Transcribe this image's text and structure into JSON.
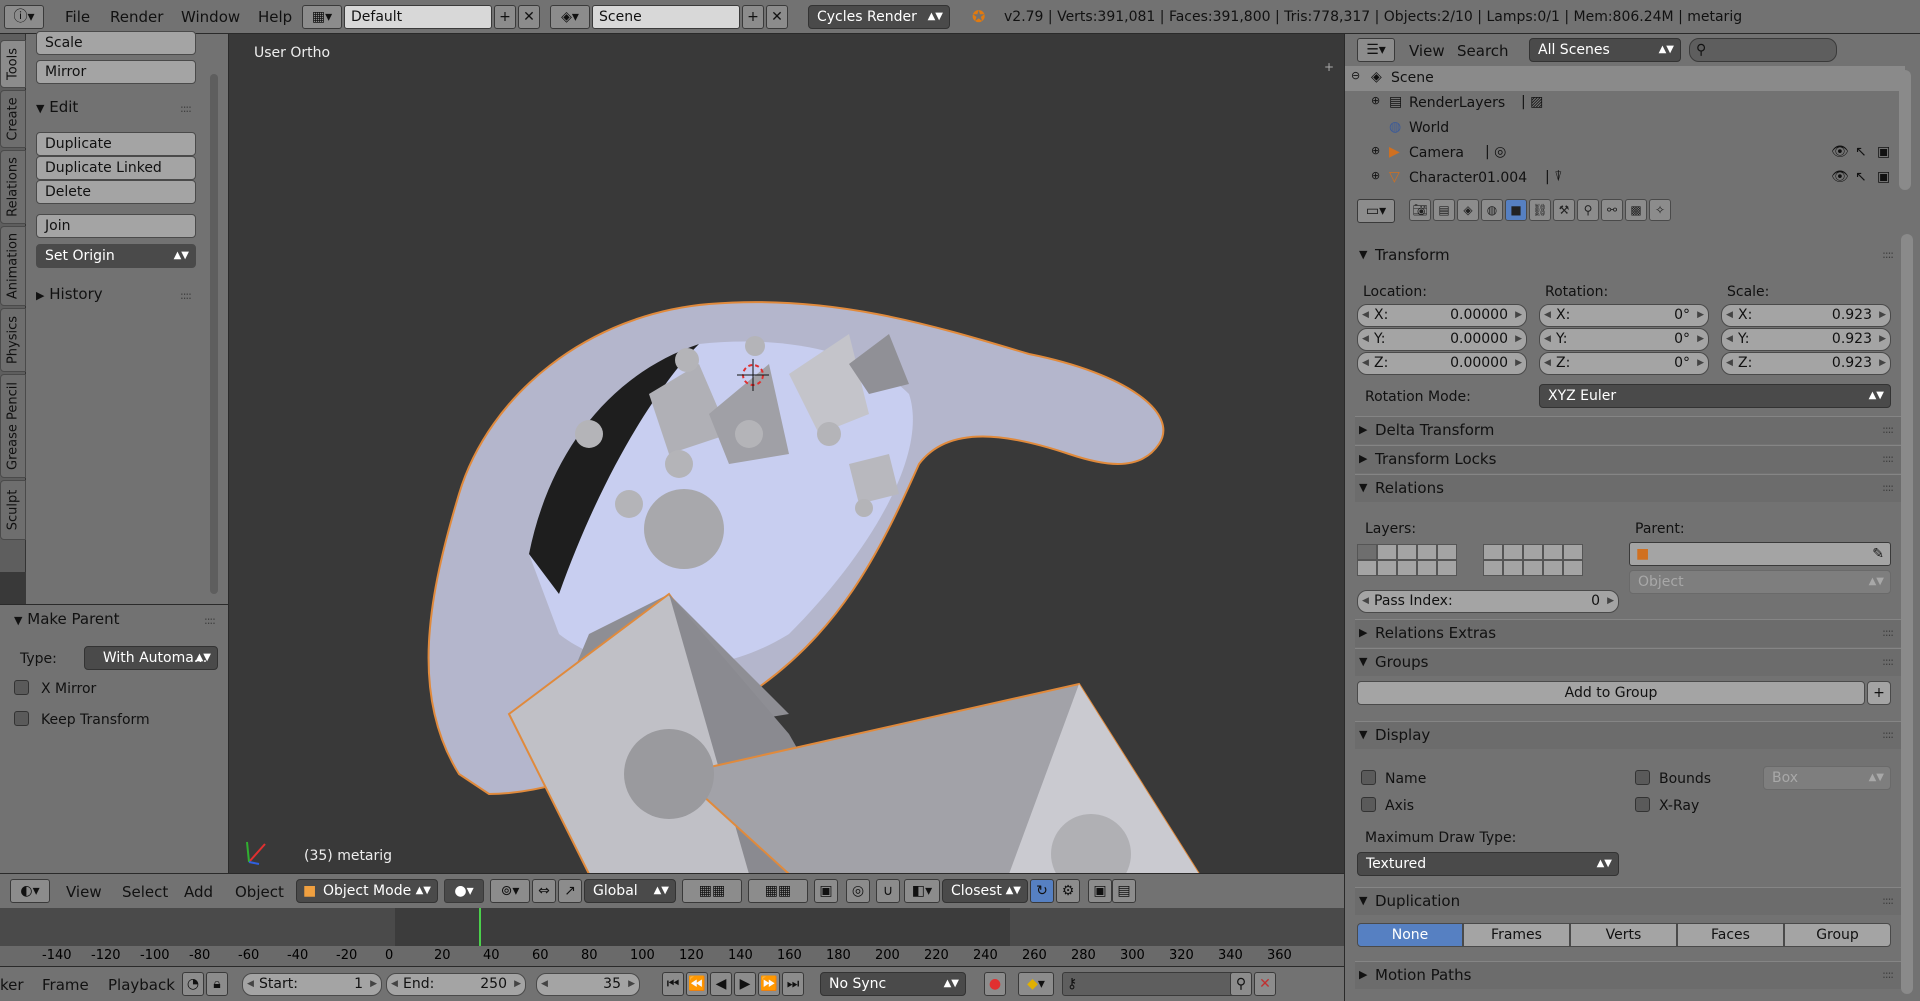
{
  "topbar": {
    "menus": [
      "File",
      "Render",
      "Window",
      "Help"
    ],
    "layout": "Default",
    "scene": "Scene",
    "engine": "Cycles Render",
    "stats": "v2.79 | Verts:391,081 | Faces:391,800 | Tris:778,317 | Objects:2/10 | Lamps:0/1 | Mem:806.24M | metarig"
  },
  "vtabs": [
    "Tools",
    "Create",
    "Relations",
    "Animation",
    "Physics",
    "Grease Pencil",
    "Sculpt"
  ],
  "toolshelf": {
    "scale": "Scale",
    "mirror": "Mirror",
    "edit_header": "Edit",
    "duplicate": "Duplicate",
    "duplicate_linked": "Duplicate Linked",
    "delete": "Delete",
    "join": "Join",
    "set_origin": "Set Origin",
    "history": "History"
  },
  "operator": {
    "title": "Make Parent",
    "type_label": "Type:",
    "type_value": "With Automa...",
    "x_mirror": "X Mirror",
    "keep_transform": "Keep Transform"
  },
  "viewport": {
    "view_label": "User Ortho",
    "object_label": "(35) metarig"
  },
  "viewbar": {
    "menus": [
      "View",
      "Select",
      "Add",
      "Object"
    ],
    "mode": "Object Mode",
    "orientation": "Global",
    "snap": "Closest"
  },
  "timeline": {
    "ticks": [
      "-140",
      "-120",
      "-100",
      "-80",
      "-60",
      "-40",
      "-20",
      "0",
      "20",
      "40",
      "60",
      "80",
      "100",
      "120",
      "140",
      "160",
      "180",
      "200",
      "220",
      "240",
      "260",
      "280",
      "300",
      "320",
      "340",
      "360"
    ],
    "current_frame_marker": 35
  },
  "timebar": {
    "menus": [
      "ker",
      "Frame",
      "Playback"
    ],
    "start_label": "Start:",
    "start": "1",
    "end_label": "End:",
    "end": "250",
    "current": "35",
    "sync": "No Sync"
  },
  "outliner": {
    "menus": [
      "View",
      "Search"
    ],
    "filter": "All Scenes",
    "items": [
      {
        "label": "Scene"
      },
      {
        "label": "RenderLayers"
      },
      {
        "label": "World"
      },
      {
        "label": "Camera"
      },
      {
        "label": "Character01.004"
      }
    ]
  },
  "properties": {
    "transform": {
      "title": "Transform",
      "location_label": "Location:",
      "rotation_label": "Rotation:",
      "scale_label": "Scale:",
      "location": [
        {
          "k": "X:",
          "v": "0.00000"
        },
        {
          "k": "Y:",
          "v": "0.00000"
        },
        {
          "k": "Z:",
          "v": "0.00000"
        }
      ],
      "rotation": [
        {
          "k": "X:",
          "v": "0°"
        },
        {
          "k": "Y:",
          "v": "0°"
        },
        {
          "k": "Z:",
          "v": "0°"
        }
      ],
      "scale": [
        {
          "k": "X:",
          "v": "0.923"
        },
        {
          "k": "Y:",
          "v": "0.923"
        },
        {
          "k": "Z:",
          "v": "0.923"
        }
      ],
      "rotation_mode_label": "Rotation Mode:",
      "rotation_mode": "XYZ Euler"
    },
    "delta_transform": "Delta Transform",
    "transform_locks": "Transform Locks",
    "relations": {
      "title": "Relations",
      "layers_label": "Layers:",
      "parent_label": "Parent:",
      "parent_type": "Object",
      "pass_index_label": "Pass Index:",
      "pass_index": "0"
    },
    "relations_extras": "Relations Extras",
    "groups": {
      "title": "Groups",
      "add": "Add to Group"
    },
    "display": {
      "title": "Display",
      "name": "Name",
      "axis": "Axis",
      "bounds": "Bounds",
      "bounds_type": "Box",
      "xray": "X-Ray",
      "max_draw_label": "Maximum Draw Type:",
      "max_draw": "Textured"
    },
    "duplication": {
      "title": "Duplication",
      "options": [
        "None",
        "Frames",
        "Verts",
        "Faces",
        "Group"
      ],
      "selected": "None"
    },
    "motion_paths": "Motion Paths"
  }
}
